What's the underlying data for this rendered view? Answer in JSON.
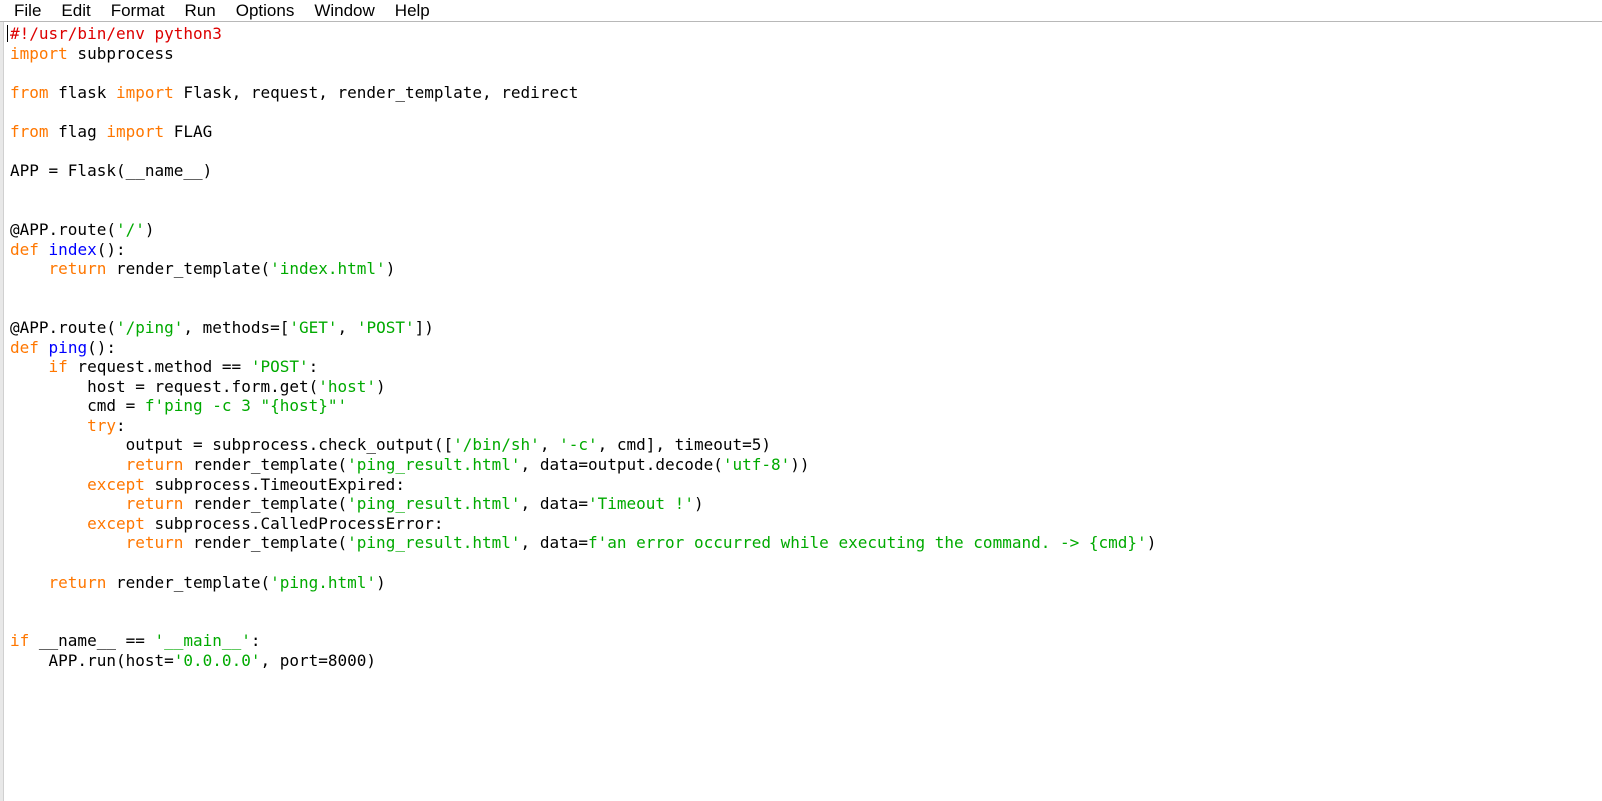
{
  "menu": [
    "File",
    "Edit",
    "Format",
    "Run",
    "Options",
    "Window",
    "Help"
  ],
  "colors": {
    "keyword": "#ff7700",
    "string": "#00aa00",
    "definition": "#0000ff",
    "comment": "#dd0000",
    "default": "#000000"
  },
  "code_lines": [
    [
      [
        "cmt",
        "#!/usr/bin/env python3"
      ]
    ],
    [
      [
        "kw",
        "import"
      ],
      [
        "",
        " subprocess"
      ]
    ],
    [],
    [
      [
        "kw",
        "from"
      ],
      [
        "",
        " flask "
      ],
      [
        "kw",
        "import"
      ],
      [
        "",
        " Flask, request, render_template, redirect"
      ]
    ],
    [],
    [
      [
        "kw",
        "from"
      ],
      [
        "",
        " flag "
      ],
      [
        "kw",
        "import"
      ],
      [
        "",
        " FLAG"
      ]
    ],
    [],
    [
      [
        "",
        "APP = Flask(__name__)"
      ]
    ],
    [],
    [],
    [
      [
        "",
        "@APP.route("
      ],
      [
        "str",
        "'/'"
      ],
      [
        "",
        ")"
      ]
    ],
    [
      [
        "kw",
        "def"
      ],
      [
        "",
        " "
      ],
      [
        "def",
        "index"
      ],
      [
        "",
        "():"
      ]
    ],
    [
      [
        "",
        "    "
      ],
      [
        "kw",
        "return"
      ],
      [
        "",
        " render_template("
      ],
      [
        "str",
        "'index.html'"
      ],
      [
        "",
        ")"
      ]
    ],
    [],
    [],
    [
      [
        "",
        "@APP.route("
      ],
      [
        "str",
        "'/ping'"
      ],
      [
        "",
        ", methods=["
      ],
      [
        "str",
        "'GET'"
      ],
      [
        "",
        ", "
      ],
      [
        "str",
        "'POST'"
      ],
      [
        "",
        "])"
      ]
    ],
    [
      [
        "kw",
        "def"
      ],
      [
        "",
        " "
      ],
      [
        "def",
        "ping"
      ],
      [
        "",
        "():"
      ]
    ],
    [
      [
        "",
        "    "
      ],
      [
        "kw",
        "if"
      ],
      [
        "",
        " request.method == "
      ],
      [
        "str",
        "'POST'"
      ],
      [
        "",
        ":"
      ]
    ],
    [
      [
        "",
        "        host = request.form.get("
      ],
      [
        "str",
        "'host'"
      ],
      [
        "",
        ")"
      ]
    ],
    [
      [
        "",
        "        cmd = "
      ],
      [
        "str",
        "f'ping -c 3 \"{host}\"'"
      ]
    ],
    [
      [
        "",
        "        "
      ],
      [
        "kw",
        "try"
      ],
      [
        "",
        ":"
      ]
    ],
    [
      [
        "",
        "            output = subprocess.check_output(["
      ],
      [
        "str",
        "'/bin/sh'"
      ],
      [
        "",
        ", "
      ],
      [
        "str",
        "'-c'"
      ],
      [
        "",
        ", cmd], timeout=5)"
      ]
    ],
    [
      [
        "",
        "            "
      ],
      [
        "kw",
        "return"
      ],
      [
        "",
        " render_template("
      ],
      [
        "str",
        "'ping_result.html'"
      ],
      [
        "",
        ", data=output.decode("
      ],
      [
        "str",
        "'utf-8'"
      ],
      [
        "",
        "))"
      ]
    ],
    [
      [
        "",
        "        "
      ],
      [
        "kw",
        "except"
      ],
      [
        "",
        " subprocess.TimeoutExpired:"
      ]
    ],
    [
      [
        "",
        "            "
      ],
      [
        "kw",
        "return"
      ],
      [
        "",
        " render_template("
      ],
      [
        "str",
        "'ping_result.html'"
      ],
      [
        "",
        ", data="
      ],
      [
        "str",
        "'Timeout !'"
      ],
      [
        "",
        ")"
      ]
    ],
    [
      [
        "",
        "        "
      ],
      [
        "kw",
        "except"
      ],
      [
        "",
        " subprocess.CalledProcessError:"
      ]
    ],
    [
      [
        "",
        "            "
      ],
      [
        "kw",
        "return"
      ],
      [
        "",
        " render_template("
      ],
      [
        "str",
        "'ping_result.html'"
      ],
      [
        "",
        ", data="
      ],
      [
        "str",
        "f'an error occurred while executing the command. -> {cmd}'"
      ],
      [
        "",
        ")"
      ]
    ],
    [],
    [
      [
        "",
        "    "
      ],
      [
        "kw",
        "return"
      ],
      [
        "",
        " render_template("
      ],
      [
        "str",
        "'ping.html'"
      ],
      [
        "",
        ")"
      ]
    ],
    [],
    [],
    [
      [
        "kw",
        "if"
      ],
      [
        "",
        " __name__ == "
      ],
      [
        "str",
        "'__main__'"
      ],
      [
        "",
        ":"
      ]
    ],
    [
      [
        "",
        "    APP.run(host="
      ],
      [
        "str",
        "'0.0.0.0'"
      ],
      [
        "",
        ", port=8000)"
      ]
    ]
  ]
}
